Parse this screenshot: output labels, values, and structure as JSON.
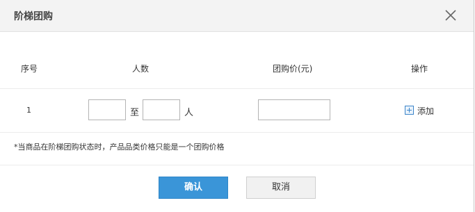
{
  "dialog": {
    "title": "阶梯团购",
    "close_icon": "close-icon"
  },
  "table": {
    "headers": {
      "index": "序号",
      "people": "人数",
      "price": "团购价(元)",
      "action": "操作"
    },
    "rows": [
      {
        "index": "1",
        "min_people": "",
        "separator": "至",
        "max_people": "",
        "unit": "人",
        "price": "",
        "add_icon": "add-square-icon",
        "add_label": "添加"
      }
    ]
  },
  "note": "*当商品在阶梯团购状态时，产品品类价格只能是一个团购价格",
  "buttons": {
    "confirm": "确认",
    "cancel": "取消"
  },
  "colors": {
    "primary": "#3a95d8",
    "header_bg": "#f3f3f3",
    "icon_blue": "#3a84c9"
  }
}
